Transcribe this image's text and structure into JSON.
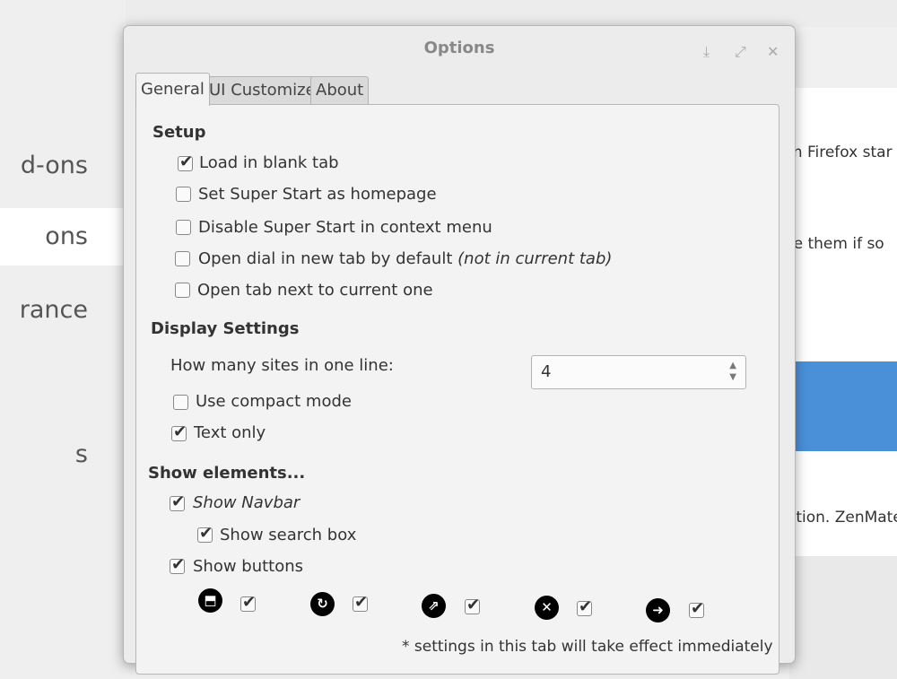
{
  "background": {
    "sidebar_items": [
      {
        "label": "d-ons",
        "active": false
      },
      {
        "label": "ons",
        "active": true
      },
      {
        "label": "rance",
        "active": false
      },
      {
        "label": "s",
        "active": false
      }
    ],
    "text_snippets": [
      "m Firefox star",
      "re them if so",
      "ction. ZenMate"
    ],
    "accent_color": "#4a90d9"
  },
  "dialog": {
    "title": "Options",
    "window_controls": {
      "minimize": "⤓",
      "maximize": "⤢",
      "close": "✕"
    },
    "tabs": [
      {
        "label": "General",
        "active": true
      },
      {
        "label": "UI Customize",
        "active": false
      },
      {
        "label": "About",
        "active": false
      }
    ],
    "setup": {
      "title": "Setup",
      "options": [
        {
          "label": "Load in blank tab",
          "checked": true
        },
        {
          "label": "Set Super Start as homepage",
          "checked": false
        },
        {
          "label": "Disable Super Start in context menu",
          "checked": false
        },
        {
          "label": "Open dial in new tab by default",
          "suffix": "(not in current tab)",
          "checked": false
        },
        {
          "label": "Open tab next to current one",
          "checked": false
        }
      ]
    },
    "display": {
      "title": "Display Settings",
      "sites_label": "How many sites in one line:",
      "sites_value": "4",
      "options": [
        {
          "label": "Use compact mode",
          "checked": false
        },
        {
          "label": "Text only",
          "checked": true
        }
      ]
    },
    "show_elements": {
      "title": "Show elements...",
      "options": [
        {
          "label": "Show Navbar",
          "checked": true
        },
        {
          "label": "Show search box",
          "checked": true
        },
        {
          "label": "Show buttons",
          "checked": true
        }
      ],
      "buttons": [
        {
          "icon": "save-icon",
          "glyph": "⬒",
          "checked": true
        },
        {
          "icon": "refresh-icon",
          "glyph": "↻",
          "checked": true
        },
        {
          "icon": "share-icon",
          "glyph": "⇗",
          "checked": true
        },
        {
          "icon": "close-icon",
          "glyph": "✕",
          "checked": true
        },
        {
          "icon": "arrow-right-icon",
          "glyph": "➜",
          "checked": true
        }
      ]
    },
    "note": "* settings in this tab will take effect immediately"
  }
}
